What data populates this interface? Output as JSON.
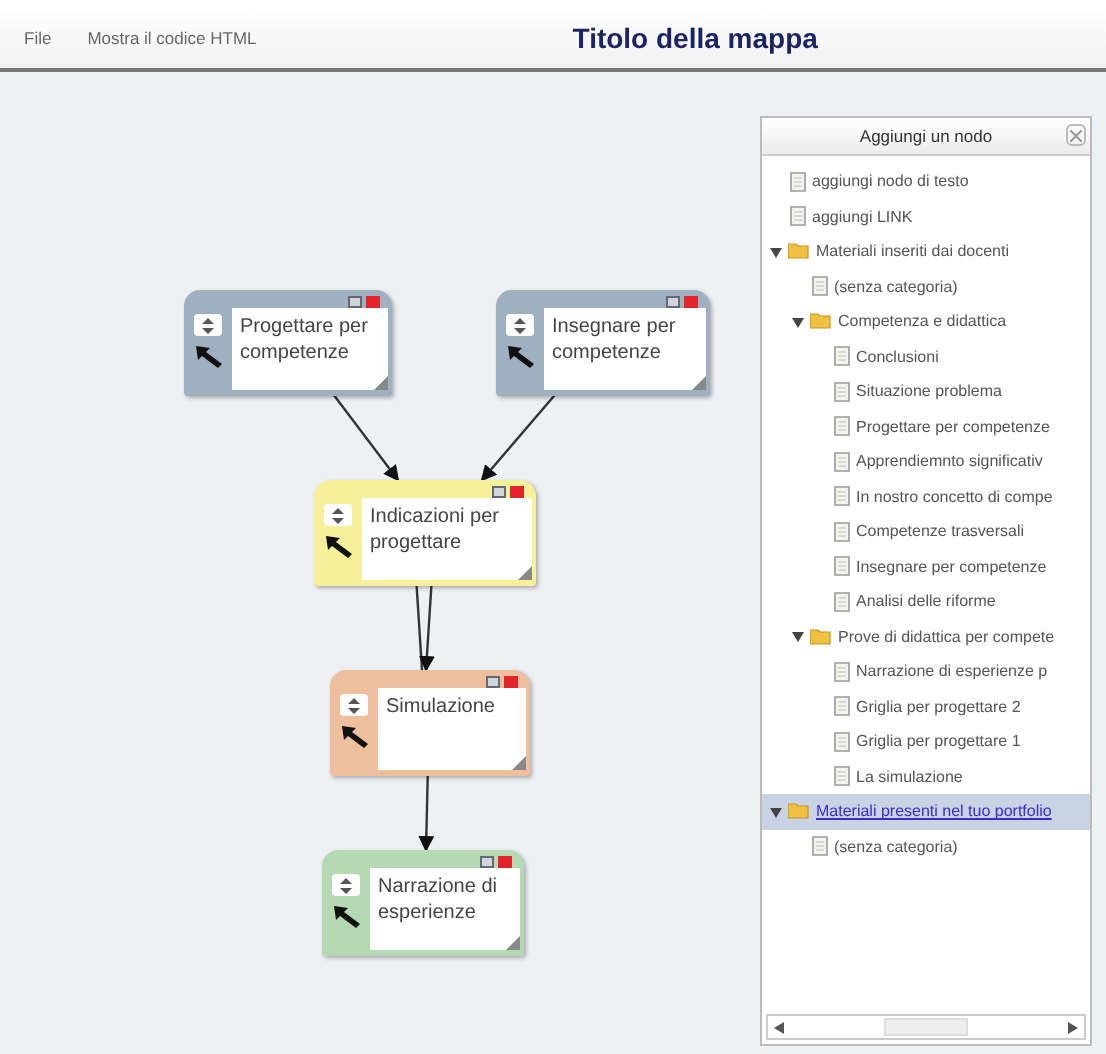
{
  "menu": [
    "File",
    "Mostra il codice HTML"
  ],
  "map_title": "Titolo della mappa",
  "nodes": [
    {
      "label": "Progettare per competenze",
      "color": "#9fb1c0"
    },
    {
      "label": "Insegnare per competenze",
      "color": "#9fb1c0"
    },
    {
      "label": "Indicazioni per progettare",
      "color": "#f7f09a"
    },
    {
      "label": "Simulazione",
      "color": "#eebf9c"
    },
    {
      "label": "Narrazione di esperienze",
      "color": "#b5d9b3"
    }
  ],
  "panel": {
    "title": "Aggiungi un nodo",
    "tree": [
      {
        "kind": "file",
        "label": "aggiungi nodo di testo",
        "selected": false
      },
      {
        "kind": "file",
        "label": "aggiungi LINK",
        "selected": false
      },
      {
        "kind": "folder",
        "label": "Materiali inseriti dai docenti",
        "expanded": true,
        "selected": false,
        "children": [
          {
            "kind": "file",
            "label": "(senza categoria)",
            "selected": false
          },
          {
            "kind": "folder",
            "label": "Competenza e didattica",
            "expanded": true,
            "selected": false,
            "children": [
              {
                "kind": "file",
                "label": "Conclusioni",
                "selected": false
              },
              {
                "kind": "file",
                "label": "Situazione problema",
                "selected": false
              },
              {
                "kind": "file",
                "label": "Progettare per competenze",
                "selected": false
              },
              {
                "kind": "file",
                "label": "Apprendiemnto significativ",
                "selected": false
              },
              {
                "kind": "file",
                "label": "In nostro concetto di compe",
                "selected": false
              },
              {
                "kind": "file",
                "label": "Competenze trasversali",
                "selected": false
              },
              {
                "kind": "file",
                "label": "Insegnare per competenze",
                "selected": false
              },
              {
                "kind": "file",
                "label": "Analisi delle riforme",
                "selected": false
              }
            ]
          },
          {
            "kind": "folder",
            "label": "Prove di didattica per compete",
            "expanded": true,
            "selected": false,
            "children": [
              {
                "kind": "file",
                "label": "Narrazione di esperienze p",
                "selected": false
              },
              {
                "kind": "file",
                "label": "Griglia per progettare 2",
                "selected": false
              },
              {
                "kind": "file",
                "label": "Griglia per progettare 1",
                "selected": false
              },
              {
                "kind": "file",
                "label": "La simulazione",
                "selected": false
              }
            ]
          }
        ]
      },
      {
        "kind": "folder",
        "label": "Materiali presenti nel tuo portfolio",
        "expanded": true,
        "selected": true,
        "children": [
          {
            "kind": "file",
            "label": "(senza categoria)",
            "selected": false
          }
        ]
      }
    ]
  }
}
